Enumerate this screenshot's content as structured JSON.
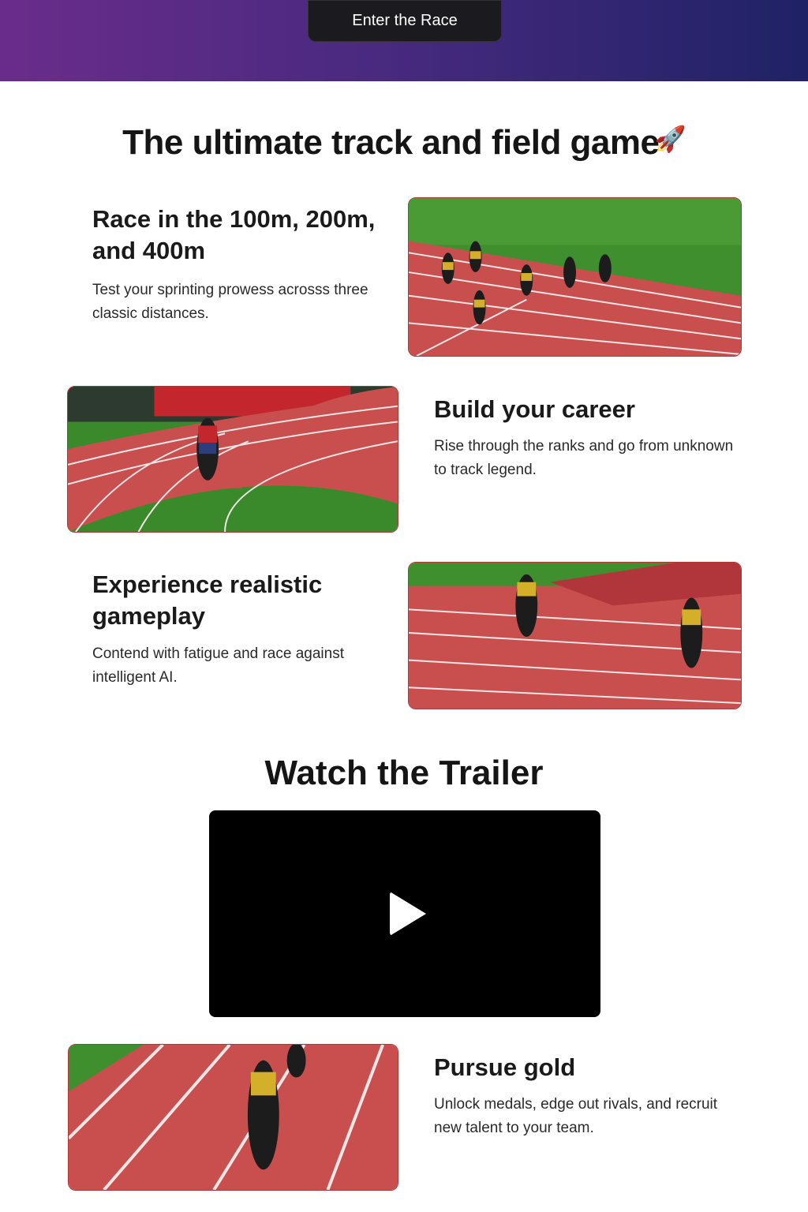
{
  "header": {
    "cta_label": "Enter the Race"
  },
  "main_title": "The ultimate track and field game",
  "main_title_emoji": "🚀",
  "features": [
    {
      "title": "Race in the 100m, 200m, and 400m",
      "description": "Test your sprinting prowess acrosss three classic distances."
    },
    {
      "title": "Build your career",
      "description": "Rise through the ranks and go from unknown to track legend."
    },
    {
      "title": "Experience realistic gameplay",
      "description": "Contend with fatigue and race against intelligent AI."
    },
    {
      "title": "Pursue gold",
      "description": "Unlock medals, edge out rivals, and recruit new talent to your team."
    }
  ],
  "trailer": {
    "title": "Watch the Trailer"
  },
  "colors": {
    "gradient_start": "#6a2c8a",
    "gradient_end": "#1f2266",
    "track": "#c94f4f",
    "grass": "#3f8f2e"
  }
}
